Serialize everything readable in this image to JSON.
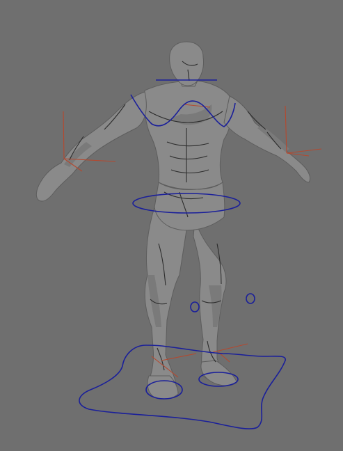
{
  "viewport": {
    "name": "3D viewport",
    "background_color": "#6f6f6f",
    "model": "humanoid-character-t-pose",
    "rig_control_color": "#1a1f9a",
    "joint_axis_color": "#b5482e"
  }
}
